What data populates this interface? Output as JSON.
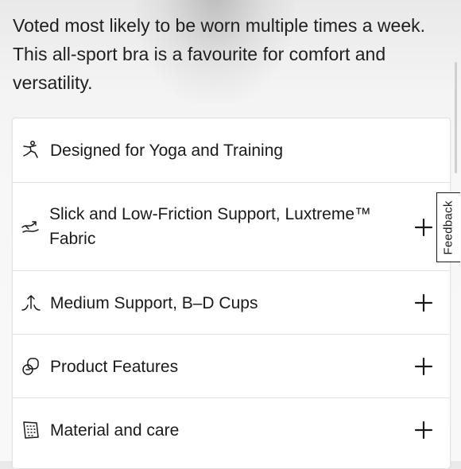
{
  "description": "Voted most likely to be worn multiple times a week. This all-sport bra is a favourite for comfort and versatility.",
  "features": [
    {
      "label": "Designed for Yoga and Training",
      "icon": "yoga-pose-icon",
      "expandable": false
    },
    {
      "label": "Slick and Low-Friction Support, Luxtreme™ Fabric",
      "icon": "swoosh-fabric-icon",
      "expandable": true
    },
    {
      "label": "Medium Support, B–D Cups",
      "icon": "support-level-icon",
      "expandable": true
    },
    {
      "label": "Product Features",
      "icon": "features-icon",
      "expandable": true
    },
    {
      "label": "Material and care",
      "icon": "fabric-swatch-icon",
      "expandable": true
    }
  ],
  "feedback_tab": {
    "label": "Feedback"
  }
}
